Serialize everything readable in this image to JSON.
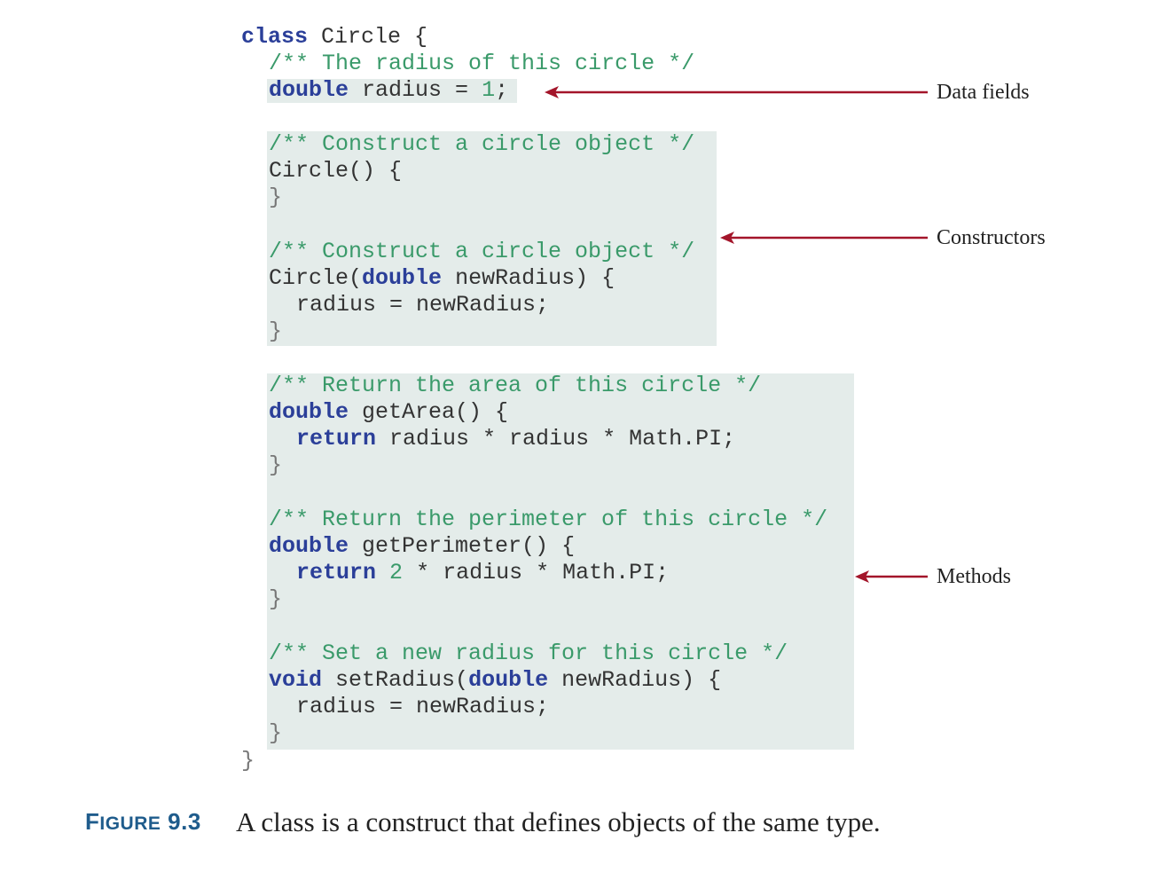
{
  "code": {
    "class_kw": "class",
    "class_name": "Circle {",
    "c_radius": "/** The radius of this circle */",
    "field_type": "double",
    "field_name": "radius =",
    "field_value": "1",
    "field_end": ";",
    "c_ctor1": "/** Construct a circle object */",
    "ctor1_sig": "Circle() {",
    "c_ctor2": "/** Construct a circle object */",
    "ctor2_name": "Circle(",
    "ctor2_type": "double",
    "ctor2_rest": "newRadius) {",
    "ctor2_body": "radius = newRadius;",
    "c_area": "/** Return the area of this circle */",
    "area_type": "double",
    "area_sig": "getArea() {",
    "area_ret_kw": "return",
    "area_ret_expr": "radius * radius * Math.PI;",
    "c_perim": "/** Return the perimeter of this circle */",
    "perim_type": "double",
    "perim_sig": "getPerimeter() {",
    "perim_ret_kw": "return",
    "perim_ret_num": "2",
    "perim_ret_expr": "* radius * Math.PI;",
    "c_set": "/** Set a new radius for this circle */",
    "set_type": "void",
    "set_name": "setRadius(",
    "set_param_type": "double",
    "set_rest": "newRadius) {",
    "set_body": "radius = newRadius;",
    "close_brace": "}"
  },
  "annotations": {
    "data_fields": "Data fields",
    "constructors": "Constructors",
    "methods": "Methods"
  },
  "caption": {
    "figure_first": "F",
    "figure_rest": "IGURE",
    "figure_num": "9.3",
    "text": "A class is a construct that defines objects of the same type."
  },
  "colors": {
    "keyword": "#2b3f99",
    "comment": "#3a9a6a",
    "highlight": "#e4ecea",
    "arrow": "#a3152a",
    "caption_label": "#1f5c8c"
  }
}
